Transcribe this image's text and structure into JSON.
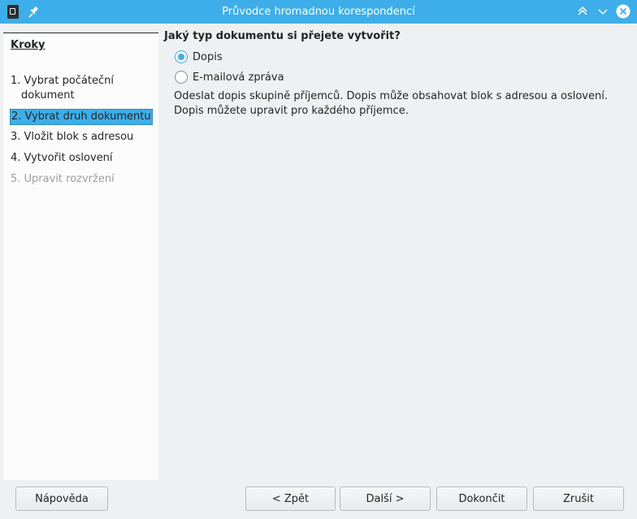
{
  "window": {
    "title": "Průvodce hromadnou korespondencí"
  },
  "steps": {
    "title": "Kroky",
    "items": [
      {
        "label": "1. Vybrat počáteční",
        "label2": "dokument"
      },
      {
        "label": "2. Vybrat druh dokumentu"
      },
      {
        "label": "3. Vložit blok s adresou"
      },
      {
        "label": "4. Vytvořit oslovení"
      },
      {
        "label": "5. Upravit rozvržení"
      }
    ]
  },
  "main": {
    "question": "Jaký typ dokumentu si přejete vytvořit?",
    "options": [
      {
        "label": "Dopis",
        "checked": true
      },
      {
        "label": "E-mailová zpráva",
        "checked": false
      }
    ],
    "description": "Odeslat dopis skupině příjemců. Dopis může obsahovat blok s adresou a oslovení. Dopis můžete upravit pro každého příjemce."
  },
  "buttons": {
    "help": "Nápověda",
    "back": "< Zpět",
    "next": "Další >",
    "finish": "Dokončit",
    "cancel": "Zrušit"
  },
  "colors": {
    "accent": "#3daee9",
    "window_bg": "#eff0f1",
    "panel_bg": "#fcfcfc"
  }
}
